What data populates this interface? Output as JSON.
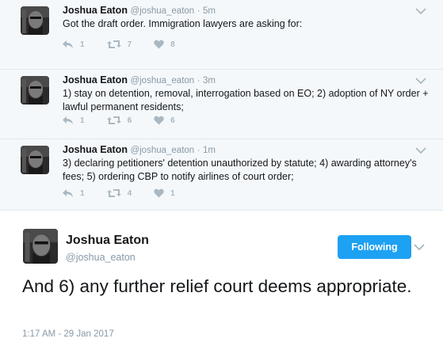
{
  "replies": [
    {
      "name": "Joshua Eaton",
      "handle": "@joshua_eaton",
      "dot": "·",
      "time": "5m",
      "text": "Got the draft order. Immigration lawyers are asking for:",
      "reply_count": "1",
      "retweet_count": "7",
      "like_count": "8"
    },
    {
      "name": "Joshua Eaton",
      "handle": "@joshua_eaton",
      "dot": "·",
      "time": "3m",
      "text": "1) stay on detention, removal, interrogation based on EO; 2) adoption of NY order + lawful permanent residents;",
      "reply_count": "1",
      "retweet_count": "6",
      "like_count": "6"
    },
    {
      "name": "Joshua Eaton",
      "handle": "@joshua_eaton",
      "dot": "·",
      "time": "1m",
      "text": "3) declaring petitioners' detention unauthorized by statute; 4) awarding attorney's fees; 5) ordering CBP to notify airlines of court order;",
      "reply_count": "1",
      "retweet_count": "4",
      "like_count": "1"
    }
  ],
  "main_tweet": {
    "name": "Joshua Eaton",
    "handle": "@joshua_eaton",
    "follow_label": "Following",
    "text": "And 6) any further relief court deems appropriate.",
    "timestamp": "1:17 AM - 29 Jan 2017"
  },
  "colors": {
    "accent": "#1da1f2",
    "muted": "#8899a6",
    "thread_bg": "#f5f8fa",
    "action_gray": "#aab8c2"
  },
  "icons": [
    "reply-icon",
    "retweet-icon",
    "like-icon",
    "chevron-down-icon",
    "avatar"
  ]
}
